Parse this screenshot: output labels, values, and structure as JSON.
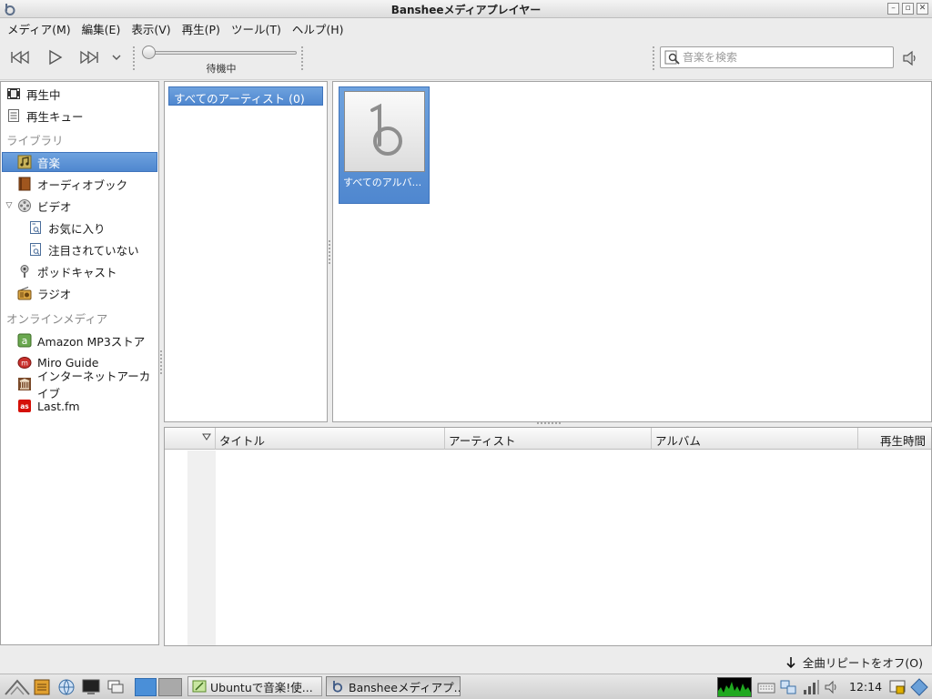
{
  "window": {
    "title": "Bansheeメディアプレイヤー"
  },
  "menubar": {
    "items": [
      {
        "label": "メディア(M)"
      },
      {
        "label": "編集(E)"
      },
      {
        "label": "表示(V)"
      },
      {
        "label": "再生(P)"
      },
      {
        "label": "ツール(T)"
      },
      {
        "label": "ヘルプ(H)"
      }
    ]
  },
  "toolbar": {
    "status": "待機中",
    "search_placeholder": "音楽を検索",
    "seek_position": 0
  },
  "sidebar": {
    "items": [
      {
        "label": "再生中",
        "icon": "now-playing-icon"
      },
      {
        "label": "再生キュー",
        "icon": "queue-icon"
      }
    ],
    "library_header": "ライブラリ",
    "library": [
      {
        "label": "音楽",
        "icon": "music-icon",
        "selected": true
      },
      {
        "label": "オーディオブック",
        "icon": "audiobook-icon"
      },
      {
        "label": "ビデオ",
        "icon": "video-icon",
        "expanded": true
      },
      {
        "label": "お気に入り",
        "icon": "smart-playlist-icon"
      },
      {
        "label": "注目されていない",
        "icon": "smart-playlist-icon"
      },
      {
        "label": "ポッドキャスト",
        "icon": "podcast-icon"
      },
      {
        "label": "ラジオ",
        "icon": "radio-icon"
      }
    ],
    "online_header": "オンラインメディア",
    "online": [
      {
        "label": "Amazon MP3ストア",
        "icon": "amazon-icon"
      },
      {
        "label": "Miro Guide",
        "icon": "miro-icon"
      },
      {
        "label": "インターネットアーカイブ",
        "icon": "archive-icon"
      },
      {
        "label": "Last.fm",
        "icon": "lastfm-icon"
      }
    ]
  },
  "artists": {
    "items": [
      {
        "label": "すべてのアーティスト (0)"
      }
    ]
  },
  "albums": {
    "items": [
      {
        "label": "すべてのアルバ..."
      }
    ]
  },
  "tracklist": {
    "columns": [
      {
        "label": "タイトル"
      },
      {
        "label": "アーティスト"
      },
      {
        "label": "アルバム"
      },
      {
        "label": "再生時間"
      }
    ]
  },
  "statusbar": {
    "repeat_label": "全曲リピートをオフ(O)"
  },
  "taskbar": {
    "tasks": [
      {
        "label": "Ubuntuで音楽!使..."
      },
      {
        "label": "Bansheeメディアプ..."
      }
    ],
    "clock": "12:14"
  },
  "colors": {
    "selection": "#5b93d6",
    "window_bg": "#ececec",
    "lastfm_red": "#d51007",
    "amazon_green": "#6aa84f"
  }
}
